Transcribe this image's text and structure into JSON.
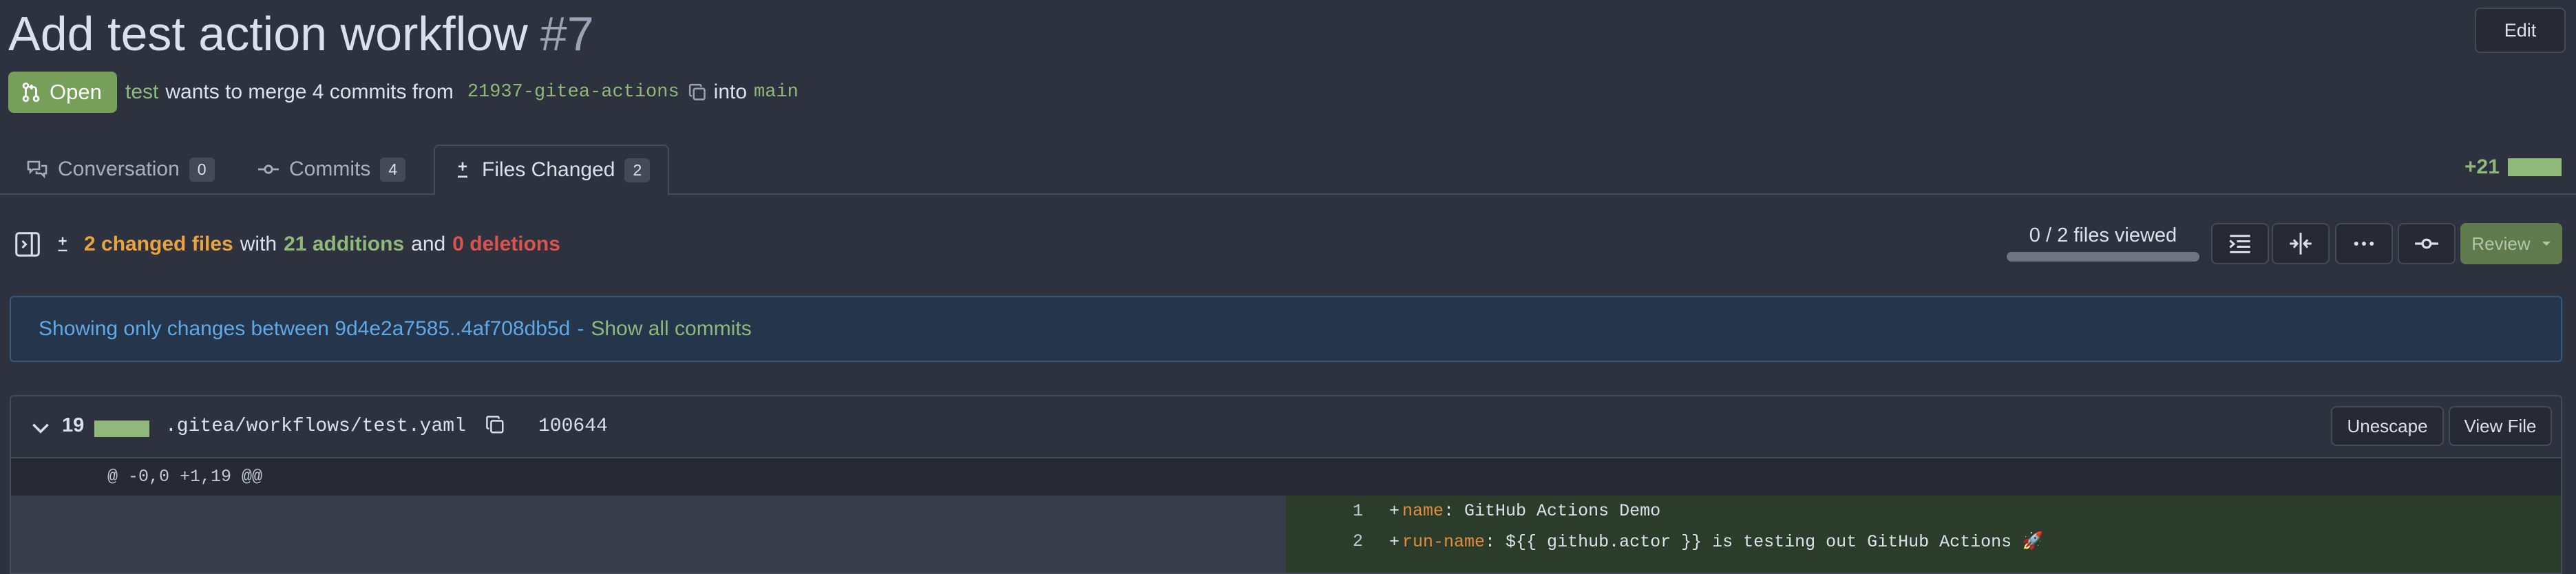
{
  "pr": {
    "title": "Add test action workflow",
    "number": "#7",
    "edit_label": "Edit",
    "state": "Open",
    "author": "test",
    "merge_text": "wants to merge 4 commits from",
    "head_branch": "21937-gitea-actions",
    "into_text": "into",
    "base_branch": "main"
  },
  "tabs": [
    {
      "label": "Conversation",
      "count": "0",
      "icon": "conversation-icon"
    },
    {
      "label": "Commits",
      "count": "4",
      "icon": "commit-icon"
    },
    {
      "label": "Files Changed",
      "count": "2",
      "icon": "diff-icon",
      "active": true
    }
  ],
  "diff_stat": {
    "additions": "+21"
  },
  "summary": {
    "changed_files": "2 changed files",
    "with": "with",
    "additions": "21 additions",
    "and": "and",
    "deletions": "0 deletions"
  },
  "viewed": {
    "label": "0 / 2 files viewed",
    "progress": 0
  },
  "toolbar": {
    "buttons": [
      "whitespace-icon",
      "expand-icon",
      "kebab-icon",
      "commit-icon"
    ],
    "review_label": "Review"
  },
  "banner": {
    "text": "Showing only changes between 9d4e2a7585..4af708db5d",
    "separator": "-",
    "link": "Show all commits"
  },
  "file": {
    "changes": "19",
    "name": ".gitea/workflows/test.yaml",
    "mode": "100644",
    "unescape_label": "Unescape",
    "view_file_label": "View File",
    "hunk": "@ -0,0 +1,19 @@",
    "lines": [
      {
        "num": "1",
        "sign": "+",
        "key": "name",
        "rest": ": GitHub Actions Demo"
      },
      {
        "num": "2",
        "sign": "+",
        "key": "run-name",
        "rest": ": ${{ github.actor }} is testing out GitHub Actions 🚀"
      }
    ]
  },
  "colors": {
    "background": "#2e323e",
    "accent_green": "#76a05a",
    "addition": "#8fb97a",
    "deletion": "#d9534f",
    "files_highlight": "#e8a33f",
    "banner_text": "#5ea9e6"
  }
}
